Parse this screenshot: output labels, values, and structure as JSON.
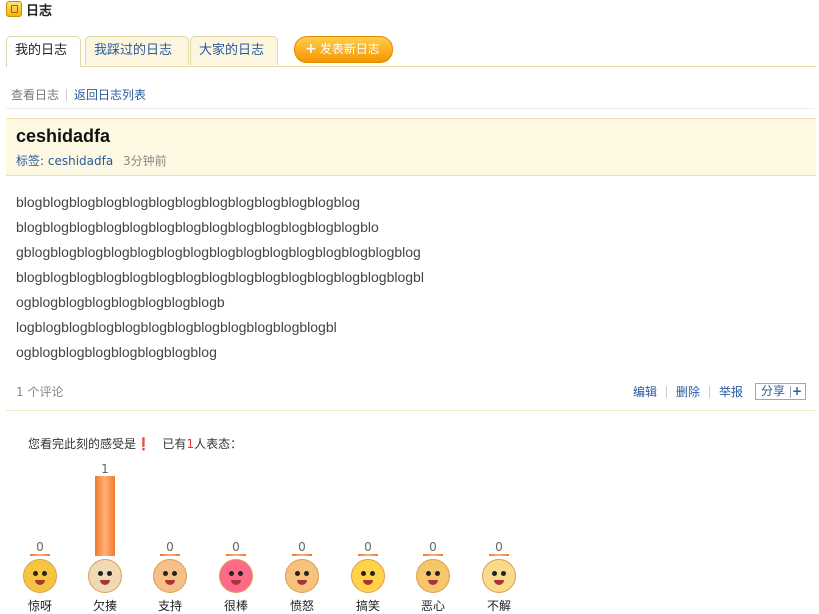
{
  "header": {
    "title": "日志"
  },
  "tabs": [
    {
      "label": "我的日志"
    },
    {
      "label": "我踩过的日志"
    },
    {
      "label": "大家的日志"
    }
  ],
  "new_button": {
    "label": "发表新日志"
  },
  "subnav": {
    "current": "查看日志",
    "back_link": "返回日志列表"
  },
  "post": {
    "title": "ceshidadfa",
    "tag_label": "标签:",
    "tag": "ceshidadfa",
    "time": "3分钟前",
    "lines": [
      "blogblogblogblogblogblogblogblogblogblogblogblogblog",
      "blogblogblogblogblogblogblogblogblogblogblogblogblogblo",
      "gblogblogblogblogblogblogblogblogblogblogblogblogblogblogblog",
      "blogblogblogblogblogblogblogblogblogblogblogblogblogblogblogbl",
      "ogblogblogblogblogblogblogblogb",
      "logblogblogblogblogblogblogblogblogblogblogblogbl",
      "ogblogblogblogblogblogblogblog"
    ]
  },
  "comments": {
    "count_text": "1 个评论"
  },
  "actions": {
    "edit": "编辑",
    "delete": "删除",
    "report": "举报",
    "share": "分享"
  },
  "mood": {
    "prompt_a": "您看完此刻的感受是",
    "prompt_b": "已有",
    "count": "1",
    "prompt_c": "人表态：",
    "items": [
      {
        "label": "惊呀",
        "count": "0",
        "value": 0,
        "color": "#f5c542"
      },
      {
        "label": "欠揍",
        "count": "1",
        "value": 1,
        "color": "#f0d9b5"
      },
      {
        "label": "支持",
        "count": "0",
        "value": 0,
        "color": "#f7c08a"
      },
      {
        "label": "很棒",
        "count": "0",
        "value": 0,
        "color": "#ff6a8a"
      },
      {
        "label": "愤怒",
        "count": "0",
        "value": 0,
        "color": "#f6c27c"
      },
      {
        "label": "搞笑",
        "count": "0",
        "value": 0,
        "color": "#ffd24a"
      },
      {
        "label": "恶心",
        "count": "0",
        "value": 0,
        "color": "#f6c66a"
      },
      {
        "label": "不解",
        "count": "0",
        "value": 0,
        "color": "#f9d98a"
      }
    ]
  }
}
